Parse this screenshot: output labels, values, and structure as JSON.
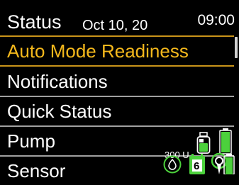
{
  "header": {
    "title": "Status",
    "date": "Oct 10, 20",
    "time": "09:00"
  },
  "menu": {
    "items": [
      {
        "label": "Auto Mode Readiness",
        "selected": true
      },
      {
        "label": "Notifications",
        "selected": false
      },
      {
        "label": "Quick Status",
        "selected": false
      },
      {
        "label": "Pump",
        "selected": false
      },
      {
        "label": "Sensor",
        "selected": false
      }
    ]
  },
  "pump": {
    "reservoir_text": "300 U",
    "reservoir_level": 1.0,
    "battery_level": 1.0
  },
  "sensor": {
    "calibration_icon": "blood-drop-icon",
    "life_days": "6",
    "connection_icon": "sensor-signal-icon",
    "battery_level": 1.0
  },
  "colors": {
    "selected_text": "#f4b81c",
    "accent_green": "#4cd13c",
    "background": "#000000"
  }
}
